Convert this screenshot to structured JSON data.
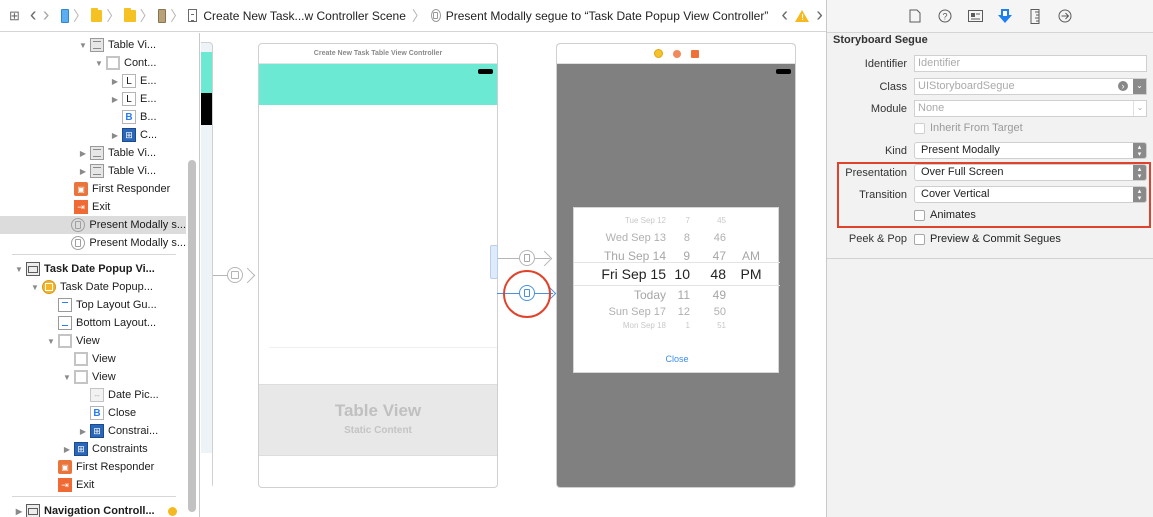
{
  "jumpbar": {
    "grid_icon": "related-items-grid-icon",
    "back": "‹",
    "forward": "›",
    "crumbs": [
      {
        "type": "project-file-icon"
      },
      {
        "type": "folder-icon"
      },
      {
        "type": "folder-icon"
      },
      {
        "type": "storyboard-file-icon"
      },
      {
        "type": "scene-icon",
        "label": "Create New Task...w Controller Scene"
      },
      {
        "type": "segue-icon",
        "label": "Present Modally segue to “Task Date Popup View Controller”"
      }
    ],
    "warning_icon": "warning-icon",
    "prev_issue": "‹",
    "next_issue": "›"
  },
  "outline": {
    "items": [
      {
        "label": "Table Vi...",
        "icon": "table-view-cell-icon",
        "indent": 0,
        "disclosure": "open"
      },
      {
        "label": "Cont...",
        "icon": "content-view-icon",
        "indent": 1,
        "disclosure": "open"
      },
      {
        "label": "E...",
        "icon": "label-icon",
        "glyph": "L",
        "indent": 2,
        "disclosure": "closed"
      },
      {
        "label": "E...",
        "icon": "label-icon",
        "glyph": "L",
        "indent": 2,
        "disclosure": "closed"
      },
      {
        "label": "B...",
        "icon": "button-icon",
        "glyph": "B",
        "indent": 2,
        "disclosure": "none"
      },
      {
        "label": "C...",
        "icon": "constraints-icon",
        "glyph": "⊞",
        "indent": 2,
        "disclosure": "closed"
      },
      {
        "label": "Table Vi...",
        "icon": "table-view-cell-icon",
        "indent": 0,
        "disclosure": "closed"
      },
      {
        "label": "Table Vi...",
        "icon": "table-view-cell-icon",
        "indent": 0,
        "disclosure": "closed"
      },
      {
        "label": "First Responder",
        "icon": "first-responder-icon",
        "indent": -1,
        "disclosure": "none"
      },
      {
        "label": "Exit",
        "icon": "exit-icon",
        "indent": -1,
        "disclosure": "none"
      },
      {
        "label": "Present Modally s...",
        "icon": "segue-icon",
        "indent": -1,
        "disclosure": "none",
        "selected": true
      },
      {
        "label": "Present Modally s...",
        "icon": "segue-icon",
        "indent": -1,
        "disclosure": "none"
      },
      {
        "label": "Task Date Popup Vi...",
        "icon": "scene-icon",
        "indent": -4,
        "disclosure": "open",
        "bold": true
      },
      {
        "label": "Task Date Popup...",
        "icon": "view-controller-icon",
        "indent": -3,
        "disclosure": "open"
      },
      {
        "label": "Top Layout Gu...",
        "icon": "top-layout-guide-icon",
        "indent": -2,
        "disclosure": "none"
      },
      {
        "label": "Bottom Layout...",
        "icon": "bottom-layout-guide-icon",
        "indent": -2,
        "disclosure": "none"
      },
      {
        "label": "View",
        "icon": "view-icon",
        "indent": -2,
        "disclosure": "open"
      },
      {
        "label": "View",
        "icon": "view-icon",
        "indent": -1,
        "disclosure": "none"
      },
      {
        "label": "View",
        "icon": "view-icon",
        "indent": -1,
        "disclosure": "open"
      },
      {
        "label": "Date Pic...",
        "icon": "date-picker-icon",
        "indent": 0,
        "disclosure": "none"
      },
      {
        "label": "Close",
        "icon": "button-icon",
        "glyph": "B",
        "indent": 0,
        "disclosure": "none"
      },
      {
        "label": "Constrai...",
        "icon": "constraints-icon",
        "glyph": "⊞",
        "indent": 0,
        "disclosure": "closed"
      },
      {
        "label": "Constraints",
        "icon": "constraints-icon",
        "glyph": "⊞",
        "indent": -1,
        "disclosure": "closed"
      },
      {
        "label": "First Responder",
        "icon": "first-responder-icon",
        "indent": -2,
        "disclosure": "none"
      },
      {
        "label": "Exit",
        "icon": "exit-icon",
        "indent": -2,
        "disclosure": "none"
      },
      {
        "label": "Navigation Controll...",
        "icon": "scene-icon",
        "indent": -4,
        "disclosure": "closed",
        "bold": true
      }
    ]
  },
  "canvas": {
    "scene1": {
      "title": "Create New Task Table View Controller",
      "header_color": "#6ce9d2",
      "table_view_title": "Table View",
      "table_view_subtitle": "Static Content"
    },
    "scene2": {
      "background_color": "#808080",
      "picker": {
        "rows": [
          {
            "date": "Tue Sep 12",
            "hour": "7",
            "minute": "45",
            "ampm": ""
          },
          {
            "date": "Wed Sep 13",
            "hour": "8",
            "minute": "46",
            "ampm": ""
          },
          {
            "date": "Thu Sep 14",
            "hour": "9",
            "minute": "47",
            "ampm": "AM"
          },
          {
            "date": "Fri Sep 15",
            "hour": "10",
            "minute": "48",
            "ampm": "PM"
          },
          {
            "date": "Today",
            "hour": "11",
            "minute": "49",
            "ampm": ""
          },
          {
            "date": "Sun Sep 17",
            "hour": "12",
            "minute": "50",
            "ampm": ""
          },
          {
            "date": "Mon Sep 18",
            "hour": "1",
            "minute": "51",
            "ampm": ""
          }
        ],
        "selected_index": 3
      },
      "close_label": "Close"
    },
    "highlight_color": "#e0432c",
    "selected_segue_color": "#4a90e2"
  },
  "inspector": {
    "tabs": [
      {
        "name": "file-inspector-icon",
        "glyph": "🗋"
      },
      {
        "name": "quick-help-icon",
        "glyph": "?"
      },
      {
        "name": "identity-inspector-icon",
        "glyph": "▤"
      },
      {
        "name": "attributes-inspector-icon",
        "glyph": "⬇",
        "active": true
      },
      {
        "name": "size-inspector-icon",
        "glyph": "▯"
      },
      {
        "name": "connections-inspector-icon",
        "glyph": "→"
      }
    ],
    "section_title": "Storyboard Segue",
    "identifier_label": "Identifier",
    "identifier_placeholder": "Identifier",
    "class_label": "Class",
    "class_value": "UIStoryboardSegue",
    "module_label": "Module",
    "module_value": "None",
    "inherit_label": "Inherit From Target",
    "kind_label": "Kind",
    "kind_value": "Present Modally",
    "presentation_label": "Presentation",
    "presentation_value": "Over Full Screen",
    "transition_label": "Transition",
    "transition_value": "Cover Vertical",
    "animates_label": "Animates",
    "animates_checked": false,
    "peek_label": "Peek & Pop",
    "peek_value_label": "Preview & Commit Segues",
    "peek_checked": false
  }
}
